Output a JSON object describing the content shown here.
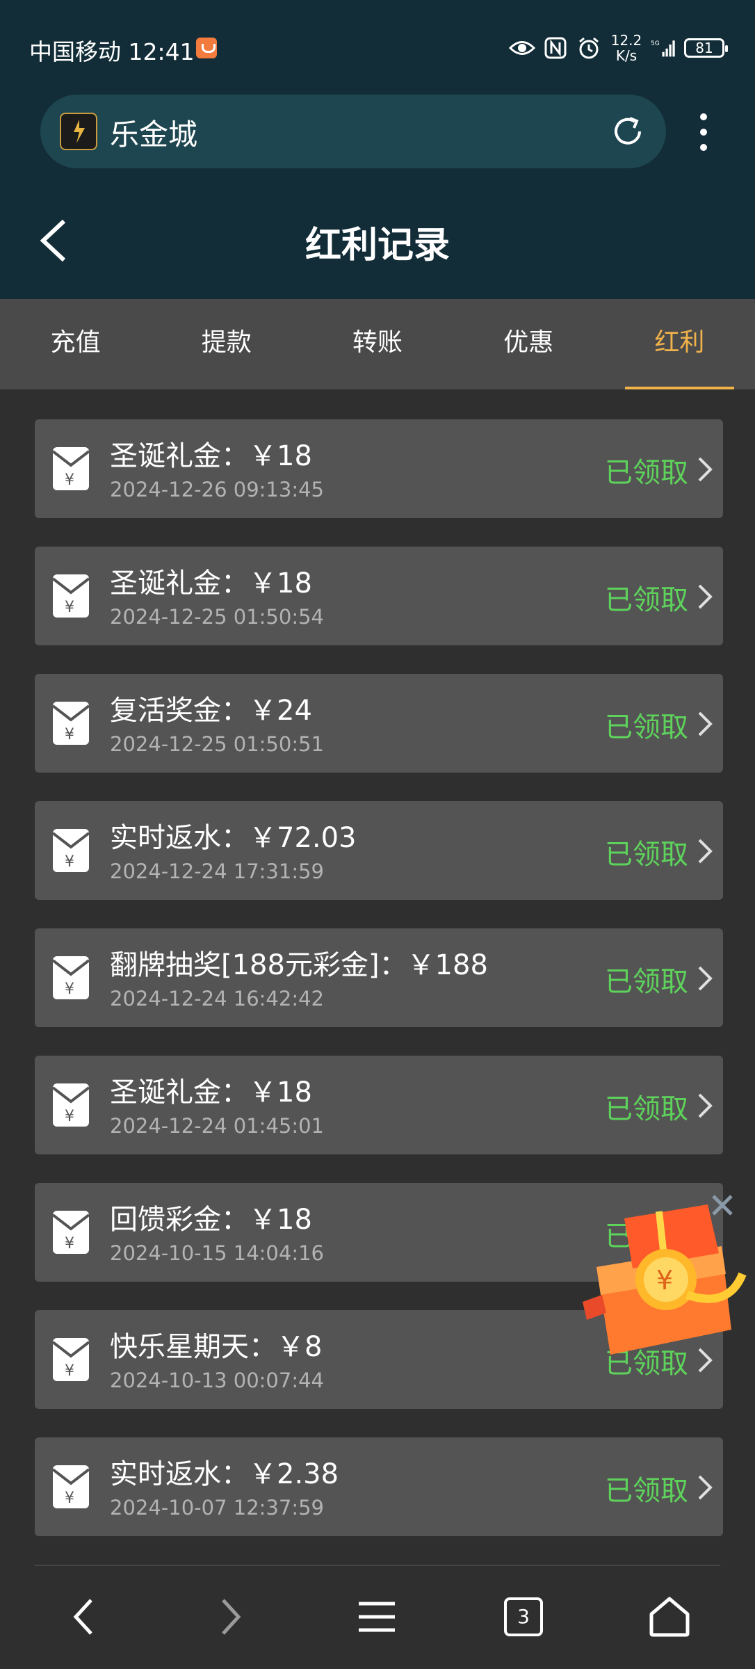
{
  "status_bar": {
    "carrier_time": "中国移动 12:41",
    "net_speed_value": "12.2",
    "net_speed_unit": "K/s",
    "net_type": "5G",
    "battery": "81"
  },
  "browser": {
    "site_name": "乐金城"
  },
  "header": {
    "title": "红利记录"
  },
  "tabs": [
    {
      "label": "充值",
      "active": false
    },
    {
      "label": "提款",
      "active": false
    },
    {
      "label": "转账",
      "active": false
    },
    {
      "label": "优惠",
      "active": false
    },
    {
      "label": "红利",
      "active": true
    }
  ],
  "records": [
    {
      "name": "圣诞礼金：￥18",
      "date": "2024-12-26 09:13:45",
      "status": "已领取"
    },
    {
      "name": "圣诞礼金：￥18",
      "date": "2024-12-25 01:50:54",
      "status": "已领取"
    },
    {
      "name": "复活奖金：￥24",
      "date": "2024-12-25 01:50:51",
      "status": "已领取"
    },
    {
      "name": "实时返水：￥72.03",
      "date": "2024-12-24 17:31:59",
      "status": "已领取"
    },
    {
      "name": "翻牌抽奖[188元彩金]：￥188",
      "date": "2024-12-24 16:42:42",
      "status": "已领取"
    },
    {
      "name": "圣诞礼金：￥18",
      "date": "2024-12-24 01:45:01",
      "status": "已领取"
    },
    {
      "name": "回馈彩金：￥18",
      "date": "2024-10-15 14:04:16",
      "status": "已领取"
    },
    {
      "name": "快乐星期天：￥8",
      "date": "2024-10-13 00:07:44",
      "status": "已领取"
    },
    {
      "name": "实时返水：￥2.38",
      "date": "2024-10-07 12:37:59",
      "status": "已领取"
    }
  ],
  "bottom_nav": {
    "tab_count": "3"
  },
  "colors": {
    "header_bg": "#122d37",
    "tab_active": "#f0b24a",
    "status_green": "#5ed35b",
    "card_bg": "#545454"
  }
}
